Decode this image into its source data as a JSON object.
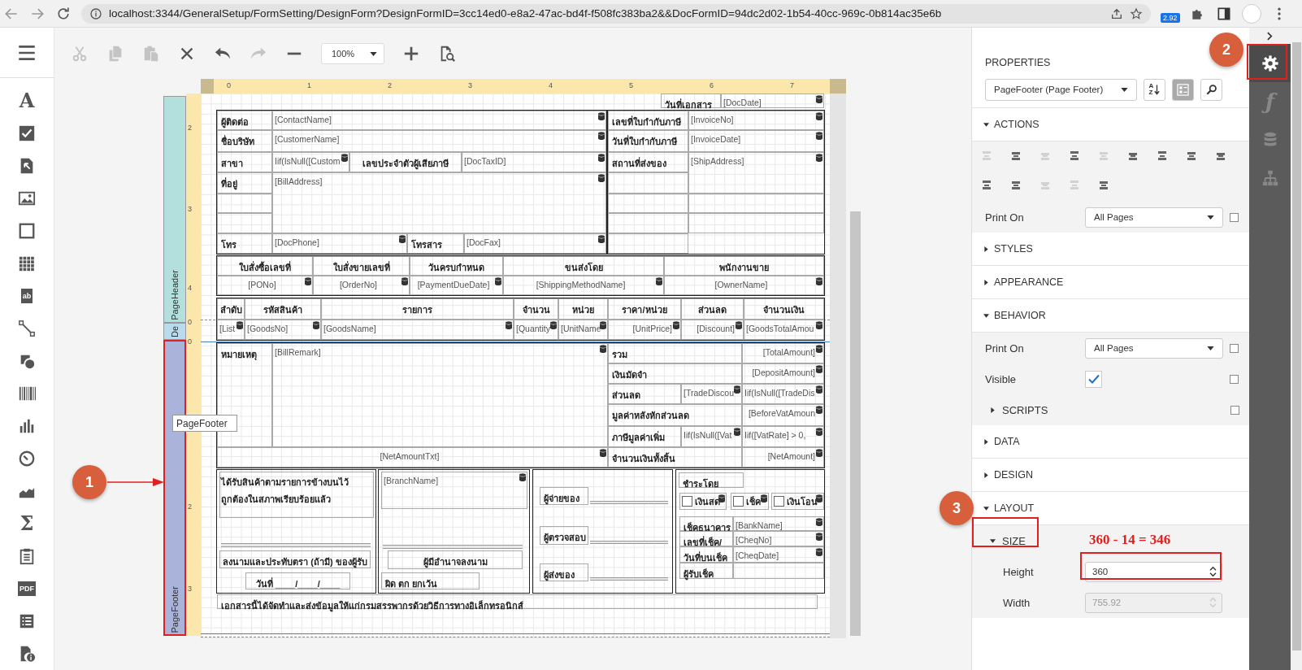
{
  "browser": {
    "url": "localhost:3344/GeneralSetup/FormSetting/DesignForm?DesignFormID=3cc14ed0-e8a2-47ac-bd4f-f508fc383ba2&&DocFormID=94dc2d02-1b54-40cc-969c-0b814ac35e6b",
    "badge": "2.92"
  },
  "toolbox": [
    {
      "kind": "glyph",
      "glyph": "A"
    },
    {
      "kind": "checkbox"
    },
    {
      "kind": "richtext"
    },
    {
      "kind": "image"
    },
    {
      "kind": "rectangle"
    },
    {
      "kind": "table"
    },
    {
      "kind": "boxed_glyph",
      "glyph": "ab"
    },
    {
      "kind": "line"
    },
    {
      "kind": "shape"
    },
    {
      "kind": "barcode"
    },
    {
      "kind": "chart"
    },
    {
      "kind": "gauge"
    },
    {
      "kind": "sparkline"
    },
    {
      "kind": "glyph",
      "glyph": "Σ"
    },
    {
      "kind": "clipboard"
    },
    {
      "kind": "boxed_glyph",
      "glyph": "PDF"
    },
    {
      "kind": "list"
    },
    {
      "kind": "info"
    }
  ],
  "toolbar": [
    {
      "kind": "cut",
      "disabled": true
    },
    {
      "kind": "copy",
      "disabled": true
    },
    {
      "kind": "paste",
      "disabled": true
    },
    {
      "kind": "delete",
      "disabled": false
    },
    {
      "kind": "undo",
      "disabled": false
    },
    {
      "kind": "redo",
      "disabled": true
    },
    {
      "kind": "zoom_out",
      "disabled": false
    },
    {
      "kind": "zoom_select",
      "value": "100%"
    },
    {
      "kind": "zoom_in",
      "disabled": false
    },
    {
      "kind": "preview",
      "disabled": false
    }
  ],
  "horizontal_ruler": [
    "0",
    "1",
    "2",
    "3",
    "4",
    "5",
    "6",
    "7"
  ],
  "vertical_ruler": [
    "2",
    "3",
    "4",
    "0",
    "0",
    "2",
    "3"
  ],
  "bands": [
    {
      "label": "PageHeader",
      "selected": false
    },
    {
      "label": "De",
      "selected": false
    },
    {
      "label": "PageFooter",
      "selected": true
    }
  ],
  "tooltip": "PageFooter",
  "report_cells": [
    {
      "text": "วันที่เอกสาร",
      "kind": "label"
    },
    {
      "text": "[DocDate]",
      "kind": "field"
    },
    {
      "text": "ผู้ติดต่อ",
      "kind": "label"
    },
    {
      "text": "[ContactName]",
      "kind": "field"
    },
    {
      "text": "ชื่อบริษัท",
      "kind": "label"
    },
    {
      "text": "[CustomerName]",
      "kind": "field"
    },
    {
      "text": "สาขา",
      "kind": "label"
    },
    {
      "text": "Iif(IsNull([Custom",
      "kind": "field"
    },
    {
      "text": "เลขประจำตัวผู้เสียภาษี",
      "kind": "header"
    },
    {
      "text": "[DocTaxID]",
      "kind": "field"
    },
    {
      "text": "ที่อยู่",
      "kind": "label"
    },
    {
      "text": "[BillAddress]",
      "kind": "field"
    },
    {
      "text": "โทร",
      "kind": "label"
    },
    {
      "text": "[DocPhone]",
      "kind": "field"
    },
    {
      "text": "โทรสาร",
      "kind": "label"
    },
    {
      "text": "[DocFax]",
      "kind": "field"
    },
    {
      "text": "เลขที่ใบกำกับภาษี",
      "kind": "label"
    },
    {
      "text": "[InvoiceNo]",
      "kind": "field"
    },
    {
      "text": "วันที่ใบกำกับภาษี",
      "kind": "label"
    },
    {
      "text": "[InvoiceDate]",
      "kind": "field"
    },
    {
      "text": "สถานที่ส่งของ",
      "kind": "label"
    },
    {
      "text": "[ShipAddress]",
      "kind": "field"
    },
    {
      "text": "ใบสั่งซื้อเลขที่",
      "kind": "header"
    },
    {
      "text": "ใบสั่งขายเลขที่",
      "kind": "header"
    },
    {
      "text": "วันครบกำหนด",
      "kind": "header"
    },
    {
      "text": "ขนส่งโดย",
      "kind": "header"
    },
    {
      "text": "พนักงานขาย",
      "kind": "header"
    },
    {
      "text": "[PONo]",
      "kind": "field_center"
    },
    {
      "text": "[OrderNo]",
      "kind": "field_center"
    },
    {
      "text": "[PaymentDueDate]",
      "kind": "field_center"
    },
    {
      "text": "[ShippingMethodName]",
      "kind": "field_center"
    },
    {
      "text": "[OwnerName]",
      "kind": "field_center"
    },
    {
      "text": "ลำดับ",
      "kind": "header"
    },
    {
      "text": "รหัสสินค้า",
      "kind": "header"
    },
    {
      "text": "รายการ",
      "kind": "header"
    },
    {
      "text": "จำนวน",
      "kind": "header"
    },
    {
      "text": "หน่วย",
      "kind": "header"
    },
    {
      "text": "ราคา/หน่วย",
      "kind": "header"
    },
    {
      "text": "ส่วนลด",
      "kind": "header"
    },
    {
      "text": "จำนวนเงิน",
      "kind": "header"
    },
    {
      "text": "[List",
      "kind": "field"
    },
    {
      "text": "[GoodsNo]",
      "kind": "field"
    },
    {
      "text": "[GoodsName]",
      "kind": "field"
    },
    {
      "text": "[Quantity",
      "kind": "field"
    },
    {
      "text": "[UnitName",
      "kind": "field"
    },
    {
      "text": "[UnitPrice]",
      "kind": "field_right"
    },
    {
      "text": "[Discount]",
      "kind": "field_right"
    },
    {
      "text": "[GoodsTotalAmou",
      "kind": "field"
    },
    {
      "text": "หมายเหตุ",
      "kind": "label"
    },
    {
      "text": "[BillRemark]",
      "kind": "field"
    },
    {
      "text": "[NetAmountTxt]",
      "kind": "field_center"
    },
    {
      "text": "รวม",
      "kind": "label"
    },
    {
      "text": "[TotalAmount]",
      "kind": "field_right"
    },
    {
      "text": "เงินมัดจำ",
      "kind": "label"
    },
    {
      "text": "[DepositAmount]",
      "kind": "field_right"
    },
    {
      "text": "ส่วนลด",
      "kind": "label"
    },
    {
      "text": "[TradeDiscou",
      "kind": "field"
    },
    {
      "text": "Iif(IsNull([TradeDis",
      "kind": "field"
    },
    {
      "text": "มูลค่าหลังหักส่วนลด",
      "kind": "label"
    },
    {
      "text": "[BeforeVatAmoun",
      "kind": "field_right"
    },
    {
      "text": "ภาษีมูลค่าเพิ่ม",
      "kind": "label"
    },
    {
      "text": "Iif(IsNull([Vat",
      "kind": "field"
    },
    {
      "text": "Iif([VatRate] > 0,",
      "kind": "field"
    },
    {
      "text": "จำนวนเงินทั้งสิ้น",
      "kind": "label"
    },
    {
      "text": "[NetAmount]",
      "kind": "field_right"
    },
    {
      "text": "ได้รับสินค้าตามรายการข้างบนไว้",
      "kind": "note"
    },
    {
      "text": "ถูกต้องในสภาพเรียบร้อยแล้ว",
      "kind": "note"
    },
    {
      "text": "ลงนามและประทับตรา (ถ้ามี) ของผู้รับ",
      "kind": "header"
    },
    {
      "text": "วันที่ ____/____/____",
      "kind": "header"
    },
    {
      "text": "[BranchName]",
      "kind": "field"
    },
    {
      "text": "ผู้มีอำนาจลงนาม",
      "kind": "header"
    },
    {
      "text": "ผิด ตก ยกเว้น",
      "kind": "label"
    },
    {
      "text": "ผู้จ่ายของ",
      "kind": "label"
    },
    {
      "text": "ผู้ตรวจสอบ",
      "kind": "label"
    },
    {
      "text": "ผู้ส่งของ",
      "kind": "label"
    },
    {
      "text": "ชำระโดย",
      "kind": "label"
    },
    {
      "text": "เงินสด",
      "kind": "check_field",
      "checked": false
    },
    {
      "text": "เช็ค",
      "kind": "check_field",
      "checked": false
    },
    {
      "text": "เงินโอน",
      "kind": "check_field",
      "checked": false
    },
    {
      "text": "เช็คธนาคาร",
      "kind": "label"
    },
    {
      "text": "[BankName]",
      "kind": "field"
    },
    {
      "text": "เลขที่เช็ค/",
      "kind": "label"
    },
    {
      "text": "[CheqNo]",
      "kind": "field"
    },
    {
      "text": "วันที่บนเช็ค",
      "kind": "label"
    },
    {
      "text": "[CheqDate]",
      "kind": "field"
    },
    {
      "text": "ผู้รับเช็ค",
      "kind": "label"
    },
    {
      "text": "เอกสารนี้ได้จัดทำและส่งข้อมูลให้แก่กรมสรรพากรด้วยวิธีการทางอิเล็กทรอนิกส์",
      "kind": "label"
    }
  ],
  "properties": {
    "title": "PROPERTIES",
    "object": "PageFooter (Page Footer)",
    "sort_labels": [
      "A",
      "Z"
    ],
    "sections": [
      {
        "label": "ACTIONS",
        "expanded": true,
        "rows": [
          {
            "kind": "icons",
            "icons": [
              {
                "disabled": true
              },
              {
                "disabled": false
              },
              {
                "disabled": true
              },
              {
                "disabled": false
              },
              {
                "disabled": true
              },
              {
                "disabled": false
              },
              {
                "disabled": false
              },
              {
                "disabled": false
              },
              {
                "disabled": false
              },
              {
                "disabled": false
              },
              {
                "disabled": false
              },
              {
                "disabled": true
              },
              {
                "disabled": true
              },
              {
                "disabled": false
              }
            ]
          },
          {
            "kind": "select",
            "label": "Print On",
            "value": "All Pages"
          }
        ]
      },
      {
        "label": "STYLES",
        "expanded": false
      },
      {
        "label": "APPEARANCE",
        "expanded": false
      },
      {
        "label": "BEHAVIOR",
        "expanded": true,
        "rows": [
          {
            "kind": "select",
            "label": "Print On",
            "value": "All Pages"
          },
          {
            "kind": "checkbox",
            "label": "Visible",
            "checked": true
          },
          {
            "kind": "group",
            "label": "SCRIPTS",
            "expanded": false
          }
        ]
      },
      {
        "label": "DATA",
        "expanded": false
      },
      {
        "label": "DESIGN",
        "expanded": false
      },
      {
        "label": "LAYOUT",
        "expanded": true,
        "rows": [
          {
            "kind": "group",
            "label": "SIZE",
            "expanded": true
          },
          {
            "kind": "number",
            "label": "Height",
            "value": "360",
            "disabled": false
          },
          {
            "kind": "number",
            "label": "Width",
            "value": "755.92",
            "disabled": true
          }
        ]
      }
    ]
  },
  "side_tabs": [
    {
      "kind": "gear",
      "selected": true
    },
    {
      "kind": "glyph",
      "glyph": "ƒ",
      "selected": false
    },
    {
      "kind": "database",
      "selected": false
    },
    {
      "kind": "tree",
      "selected": false
    }
  ],
  "callouts": [
    "1",
    "2",
    "3"
  ],
  "note": "360 - 14 = 346"
}
